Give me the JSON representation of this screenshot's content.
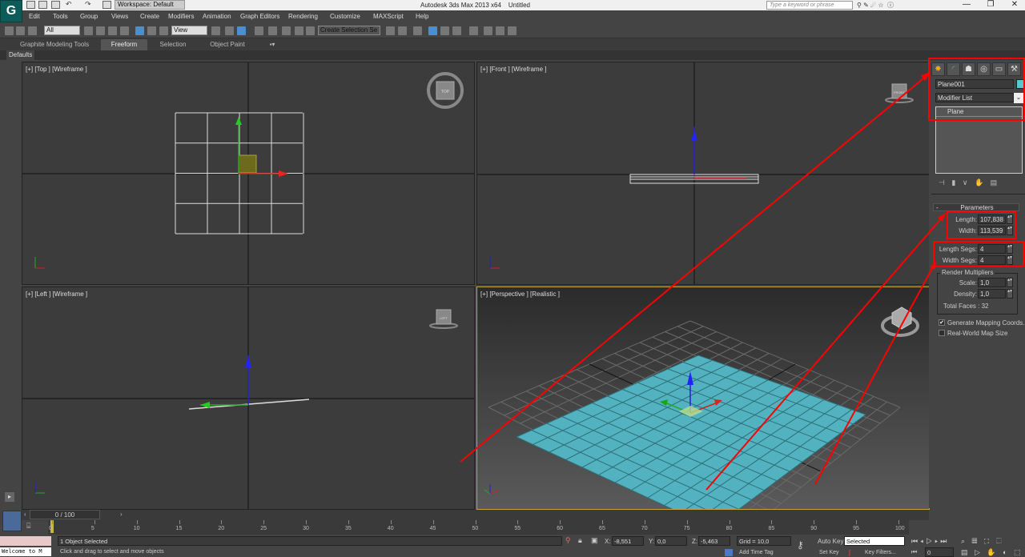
{
  "titlebar": {
    "app_title": "Autodesk 3ds Max  2013 x64",
    "doc_title": "Untitled",
    "workspace": "Workspace: Default",
    "search_placeholder": "Type a keyword or phrase",
    "minimize": "—",
    "maximize": "❐",
    "close": "✕"
  },
  "menu": [
    "Edit",
    "Tools",
    "Group",
    "Views",
    "Create",
    "Modifiers",
    "Animation",
    "Graph Editors",
    "Rendering",
    "Customize",
    "MAXScript",
    "Help"
  ],
  "toolbar": {
    "selection_filter": "All",
    "ref_coord": "View",
    "named_selection": "Create Selection Se"
  },
  "ribbon": {
    "tabs": [
      "Graphite Modeling Tools",
      "Freeform",
      "Selection",
      "Object Paint"
    ],
    "active_tab": "Freeform",
    "panel": "Defaults"
  },
  "viewports": {
    "top": "[+] [Top ] [Wireframe ]",
    "front": "[+] [Front ] [Wireframe ]",
    "left": "[+] [Left ] [Wireframe ]",
    "perspective": "[+] [Perspective ] [Realistic ]",
    "cube_top": "TOP",
    "cube_front": "FRONT",
    "cube_left": "LEFT"
  },
  "command_panel": {
    "object_name": "Plane001",
    "object_color": "#55c8d8",
    "modifier_list": "Modifier List",
    "stack_item": "Plane",
    "rollout_title": "Parameters",
    "length_label": "Length:",
    "length": "107,838",
    "width_label": "Width:",
    "width": "113,539",
    "length_segs_label": "Length Segs:",
    "length_segs": "4",
    "width_segs_label": "Width Segs:",
    "width_segs": "4",
    "render_mult_label": "Render Multipliers",
    "scale_label": "Scale:",
    "scale": "1,0",
    "density_label": "Density:",
    "density": "1,0",
    "total_faces": "Total Faces : 32",
    "gen_mapping": "Generate Mapping Coords.",
    "gen_mapping_checked": true,
    "real_world": "Real-World Map Size",
    "real_world_checked": false
  },
  "timeline": {
    "frame": "0 / 100",
    "ticks": [
      0,
      5,
      10,
      15,
      20,
      25,
      30,
      35,
      40,
      45,
      50,
      55,
      60,
      65,
      70,
      75,
      80,
      85,
      90,
      95,
      100
    ]
  },
  "status": {
    "maxscript": "Welcome to M",
    "selected": "1 Object Selected",
    "prompt": "Click and drag to select and move objects",
    "x_label": "X:",
    "x": "-8,551",
    "y_label": "Y:",
    "y": "0,0",
    "z_label": "Z:",
    "z": "-5,463",
    "grid": "Grid = 10,0",
    "add_time_tag": "Add Time Tag",
    "auto_key": "Auto Key",
    "set_key": "Set Key",
    "key_mode": "Selected",
    "key_filters": "Key Filters...",
    "current_frame": "0"
  },
  "annotation_color": "#ff0000"
}
